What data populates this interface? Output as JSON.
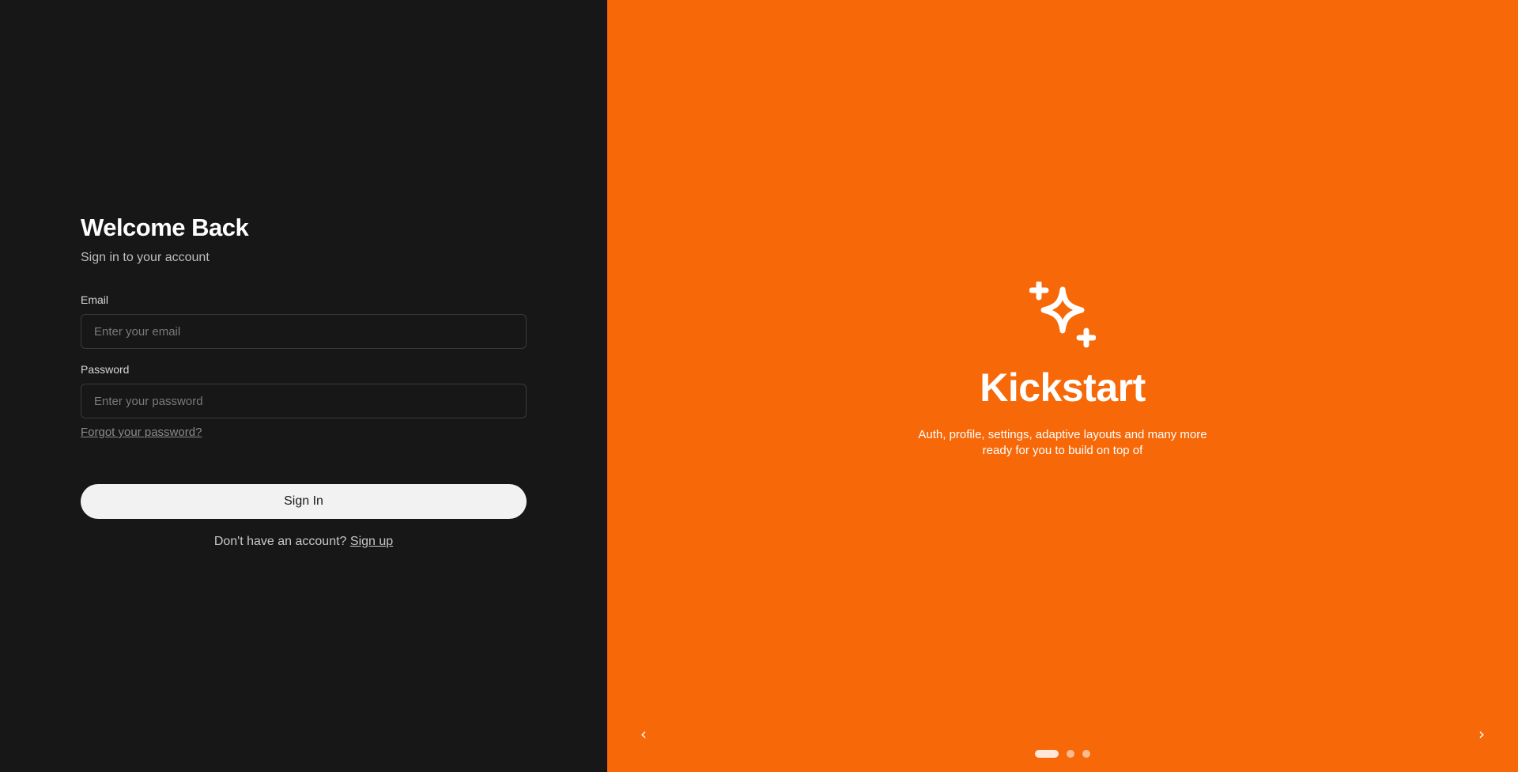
{
  "login": {
    "title": "Welcome Back",
    "subtitle": "Sign in to your account",
    "email_label": "Email",
    "email_placeholder": "Enter your email",
    "email_value": "",
    "password_label": "Password",
    "password_placeholder": "Enter your password",
    "password_value": "",
    "forgot_label": "Forgot your password?",
    "signin_label": "Sign In",
    "signup_prompt": "Don't have an account?",
    "signup_label": "Sign up"
  },
  "hero": {
    "icon": "sparkles-icon",
    "brand": "Kickstart",
    "tagline_line1": "Auth, profile, settings, adaptive layouts and many more",
    "tagline_line2": "ready for you to build on top of"
  },
  "carousel": {
    "prev_icon": "‹",
    "next_icon": "›",
    "slide_count": 3,
    "active_index": 0
  },
  "colors": {
    "left_bg": "#171717",
    "right_bg": "#f76808",
    "button_bg": "#f2f2f2"
  }
}
